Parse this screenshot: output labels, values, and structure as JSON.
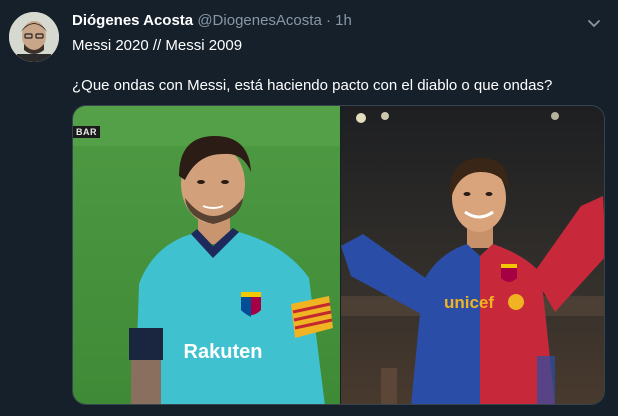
{
  "tweet": {
    "author_name": "Diógenes Acosta",
    "author_handle": "@DiogenesAcosta",
    "separator": "·",
    "time": "1h",
    "text_line_1": "Messi 2020 // Messi 2009",
    "text_line_2": "¿Que ondas con Messi, está haciendo pacto con el diablo o que ondas?"
  },
  "media": {
    "left_badge": "BAR",
    "left_sponsor": "Rakuten",
    "right_sponsor": "unicef"
  },
  "colors": {
    "background": "#15202b",
    "secondary_text": "#8899a6",
    "border": "#38444d"
  },
  "icons": {
    "menu": "chevron-down-icon"
  }
}
